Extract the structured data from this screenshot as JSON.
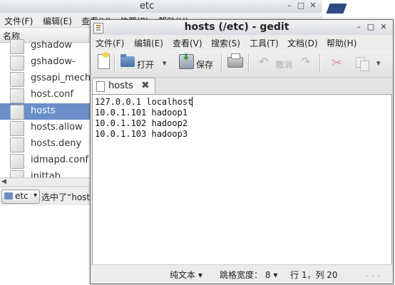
{
  "file_manager": {
    "title": "etc",
    "menu": [
      "文件(F)",
      "编辑(E)",
      "查看(V)",
      "位置(P)",
      "帮助(H)"
    ],
    "column_header": "名称",
    "files": [
      {
        "name": "gshadow",
        "selected": false
      },
      {
        "name": "gshadow-",
        "selected": false
      },
      {
        "name": "gssapi_mech.conf",
        "selected": false
      },
      {
        "name": "host.conf",
        "selected": false
      },
      {
        "name": "hosts",
        "selected": true
      },
      {
        "name": "hosts.allow",
        "selected": false
      },
      {
        "name": "hosts.deny",
        "selected": false
      },
      {
        "name": "idmapd.conf",
        "selected": false
      },
      {
        "name": "inittab",
        "selected": false
      }
    ],
    "location": "etc",
    "status_text": "选中了“hosts”"
  },
  "gedit": {
    "title": "hosts (/etc) - gedit",
    "menu": [
      "文件(F)",
      "编辑(E)",
      "查看(V)",
      "搜索(S)",
      "工具(T)",
      "文档(D)",
      "帮助(H)"
    ],
    "toolbar": {
      "open_label": "打开",
      "save_label": "保存",
      "undo_label": "撤消"
    },
    "tab": {
      "label": "hosts"
    },
    "content_lines": [
      "127.0.0.1 localhost",
      "10.0.1.101 hadoop1",
      "10.0.1.102 hadoop2",
      "10.0.1.103 hadoop3"
    ],
    "status": {
      "syntax": "纯文本",
      "tab_width_label": "跳格宽度：",
      "tab_width": "8",
      "cursor_position": "行 1，列 20"
    }
  }
}
